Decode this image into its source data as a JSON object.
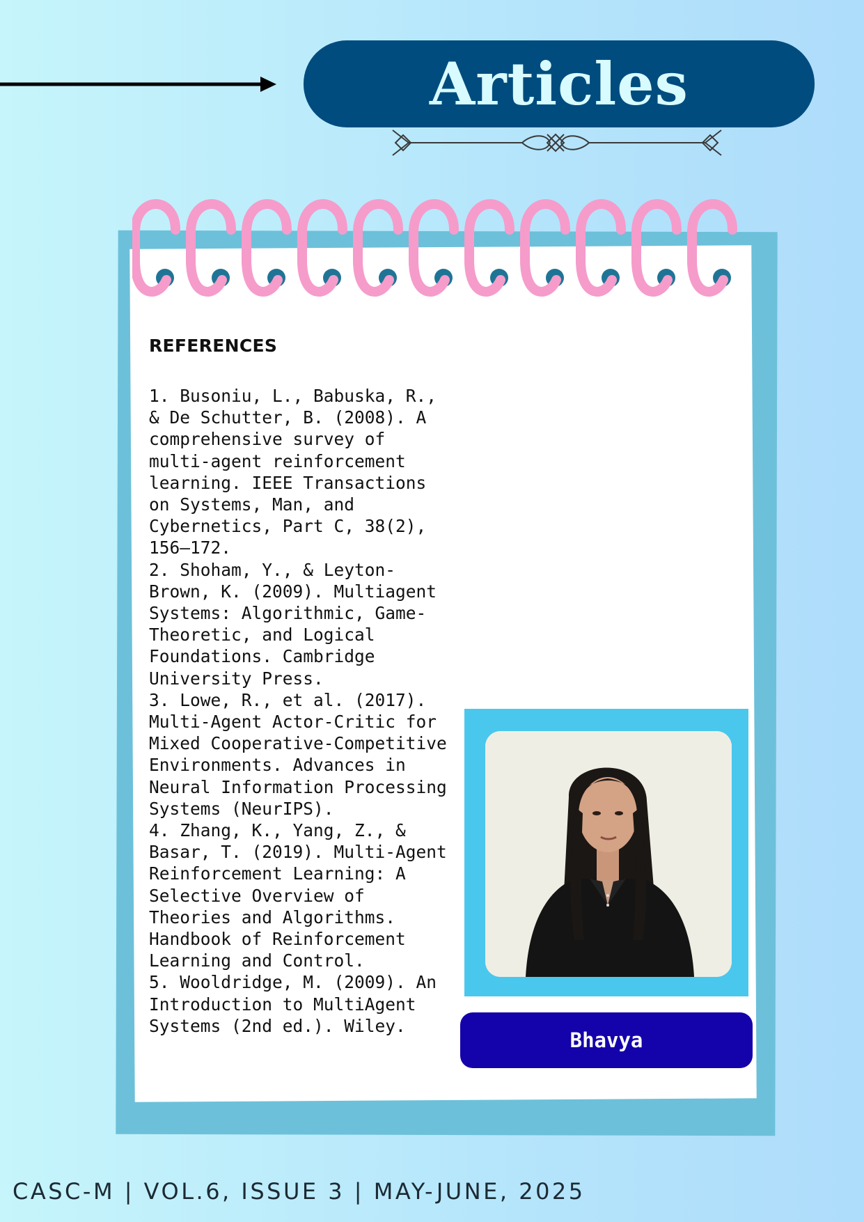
{
  "header": {
    "title": "Articles"
  },
  "references": {
    "heading": "REFERENCES",
    "items": [
      "1. Busoniu, L., Babuska, R., & De Schutter, B. (2008). A comprehensive survey of multi-agent reinforcement learning. IEEE Transactions on Systems, Man, and Cybernetics, Part C, 38(2), 156–172.",
      "2. Shoham, Y., & Leyton-Brown, K. (2009). Multiagent Systems: Algorithmic, Game-Theoretic, and Logical Foundations. Cambridge University Press.",
      "3. Lowe, R., et al. (2017). Multi-Agent Actor-Critic for Mixed Cooperative-Competitive Environments. Advances in Neural Information Processing Systems (NeurIPS).",
      "4. Zhang, K., Yang, Z., & Basar, T. (2019). Multi-Agent Reinforcement Learning: A Selective Overview of Theories and Algorithms. Handbook of Reinforcement Learning and Control.",
      "5. Wooldridge, M. (2009). An Introduction to MultiAgent Systems (2nd ed.). Wiley."
    ]
  },
  "author": {
    "name": "Bhavya"
  },
  "footer": {
    "text": "CASC-M | VOL.6, ISSUE 3 | MAY-JUNE, 2025"
  },
  "colors": {
    "title_pill": "#014c7e",
    "title_text": "#d8fbff",
    "notepad_frame": "#6dc0d9",
    "spiral_ring": "#f59ccb",
    "ring_hole": "#1f7496",
    "photo_frame": "#4ac7ed",
    "name_pill": "#1402aa"
  },
  "icons": {
    "arrow": "right-arrow-icon",
    "divider": "ornamental-divider-icon",
    "rings": "spiral-binding-icon"
  }
}
